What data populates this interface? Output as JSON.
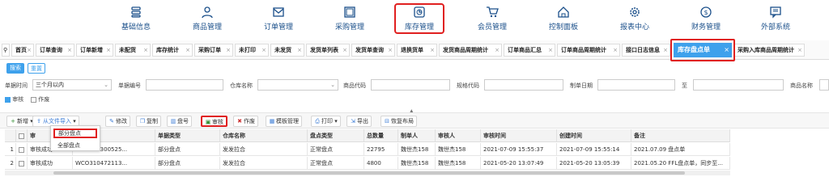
{
  "topnav": [
    {
      "label": "基础信息",
      "icon": "database-icon"
    },
    {
      "label": "商品管理",
      "icon": "user-icon"
    },
    {
      "label": "订单管理",
      "icon": "envelope-icon"
    },
    {
      "label": "采购管理",
      "icon": "window-icon"
    },
    {
      "label": "库存管理",
      "icon": "pie-chart-icon"
    },
    {
      "label": "会员管理",
      "icon": "cart-icon"
    },
    {
      "label": "控制面板",
      "icon": "home-icon"
    },
    {
      "label": "报表中心",
      "icon": "gear-icon"
    },
    {
      "label": "财务管理",
      "icon": "dollar-icon"
    },
    {
      "label": "外部系统",
      "icon": "message-icon"
    }
  ],
  "tabs": [
    "首页",
    "订单查询",
    "订单新增",
    "未配货",
    "库存统计",
    "采购订单",
    "未打印",
    "未发货",
    "发货单列表",
    "发货单查询",
    "退换货单",
    "发货商品周期统计",
    "订单商品汇总",
    "订单商品周期统计",
    "接口日志信息",
    "库存盘点单",
    "采购入库商品周期统计"
  ],
  "active_tab": "库存盘点单",
  "search_buttons": {
    "search": "搜索",
    "reset": "重置"
  },
  "filters": {
    "time_label": "单据时间",
    "time_value": "三个月以内",
    "doc_no_label": "单据编号",
    "warehouse_label": "仓库名称",
    "product_code_label": "商品代码",
    "spec_code_label": "规格代码",
    "made_date_label": "制单日期",
    "to_label": "至",
    "product_name_label": "商品名称",
    "audit_label": "审核",
    "void_label": "作废"
  },
  "toolbar": {
    "new": "新增",
    "import": "从文件导入",
    "edit": "修改",
    "copy": "复制",
    "reorder": "盘号",
    "audit": "审核",
    "void": "作废",
    "template": "模板管理",
    "print": "打印",
    "export": "导出",
    "restore": "恢复布局"
  },
  "dropdown": {
    "partial": "部分盘点",
    "full": "全部盘点"
  },
  "columns": [
    "",
    "",
    "审",
    "单据号",
    "单据类型",
    "仓库名称",
    "盘点类型",
    "总数量",
    "制单人",
    "审核人",
    "审核时间",
    "创建时间",
    "备注"
  ],
  "rows": [
    {
      "n": "1",
      "status": "审核成功",
      "no": "WCO322300525...",
      "type": "部分盘点",
      "warehouse": "发发拉合",
      "kind": "正常盘点",
      "qty": "22795",
      "maker": "魏世杰158",
      "auditor": "魏世杰158",
      "audit_time": "2021-07-09 15:55:37",
      "create_time": "2021-07-09 15:55:14",
      "note": "2021.07.09 盘点单"
    },
    {
      "n": "2",
      "status": "审核成功",
      "no": "WCO310472113...",
      "type": "部分盘点",
      "warehouse": "发发拉合",
      "kind": "正常盘点",
      "qty": "4800",
      "maker": "魏世杰158",
      "auditor": "魏世杰158",
      "audit_time": "2021-05-20 13:07:49",
      "create_time": "2021-05-20 13:05:39",
      "note": "2021.05.20 FFL盘点单，同步至..."
    }
  ],
  "colors": {
    "accent": "#3ea1ec",
    "highlight": "#e02020",
    "nav_text": "#1a4f8a"
  }
}
